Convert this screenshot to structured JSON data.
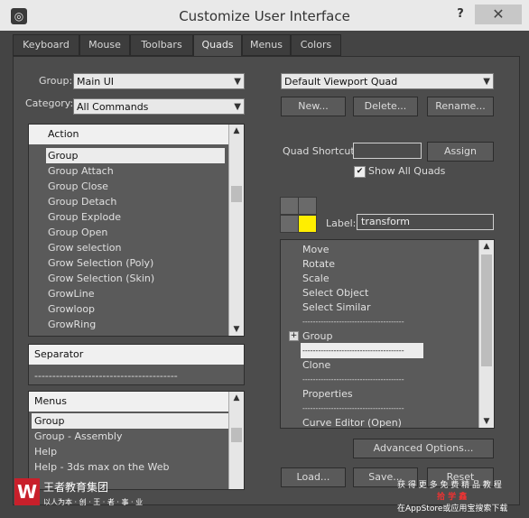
{
  "window": {
    "title": "Customize User Interface",
    "help": "?",
    "close": "✕"
  },
  "tabs": [
    "Keyboard",
    "Mouse",
    "Toolbars",
    "Quads",
    "Menus",
    "Colors"
  ],
  "left": {
    "group_label": "Group:",
    "group_value": "Main UI",
    "category_label": "Category:",
    "category_value": "All Commands",
    "action_header": "Action",
    "actions": [
      "Group",
      "Group Attach",
      "Group Close",
      "Group Detach",
      "Group Explode",
      "Group Open",
      "Grow selection",
      "Grow Selection (Poly)",
      "Grow Selection (Skin)",
      "GrowLine",
      "Growloop",
      "GrowRing"
    ],
    "separator_header": "Separator",
    "separator_line": "----------------------------------------",
    "menus_header": "Menus",
    "menus": [
      "Group",
      "Group - Assembly",
      "Help",
      "Help - 3ds max on the Web"
    ]
  },
  "right": {
    "quad_set": "Default Viewport Quad",
    "new": "New...",
    "delete": "Delete...",
    "rename": "Rename...",
    "shortcut_label": "Quad Shortcut:",
    "shortcut_value": "",
    "assign": "Assign",
    "show_all_quads": "Show All Quads",
    "show_all_checked": "✔",
    "label_label": "Label:",
    "label_value": "transform",
    "quad_highlight_color": "#ffee00",
    "items": [
      "Move",
      "Rotate",
      "Scale",
      "Select Object",
      "Select Similar",
      "---------------------------------------",
      "Group",
      "---------------------------------------",
      "Clone",
      "---------------------------------------",
      "Properties",
      "---------------------------------------",
      "Curve Editor (Open)"
    ],
    "expand": "+",
    "advanced": "Advanced Options...",
    "load": "Load...",
    "save": "Save...",
    "reset": "Reset"
  },
  "watermark": {
    "left_text": "王者教育集团",
    "left_sub": "以人为本 · 创 · 王 · 者 · 事 · 业",
    "right_line1": "获 得 更 多 免 费 精 品 教 程",
    "right_line2": "拾 学 鑫",
    "right_line3": "在AppStore或应用宝搜索下载"
  }
}
